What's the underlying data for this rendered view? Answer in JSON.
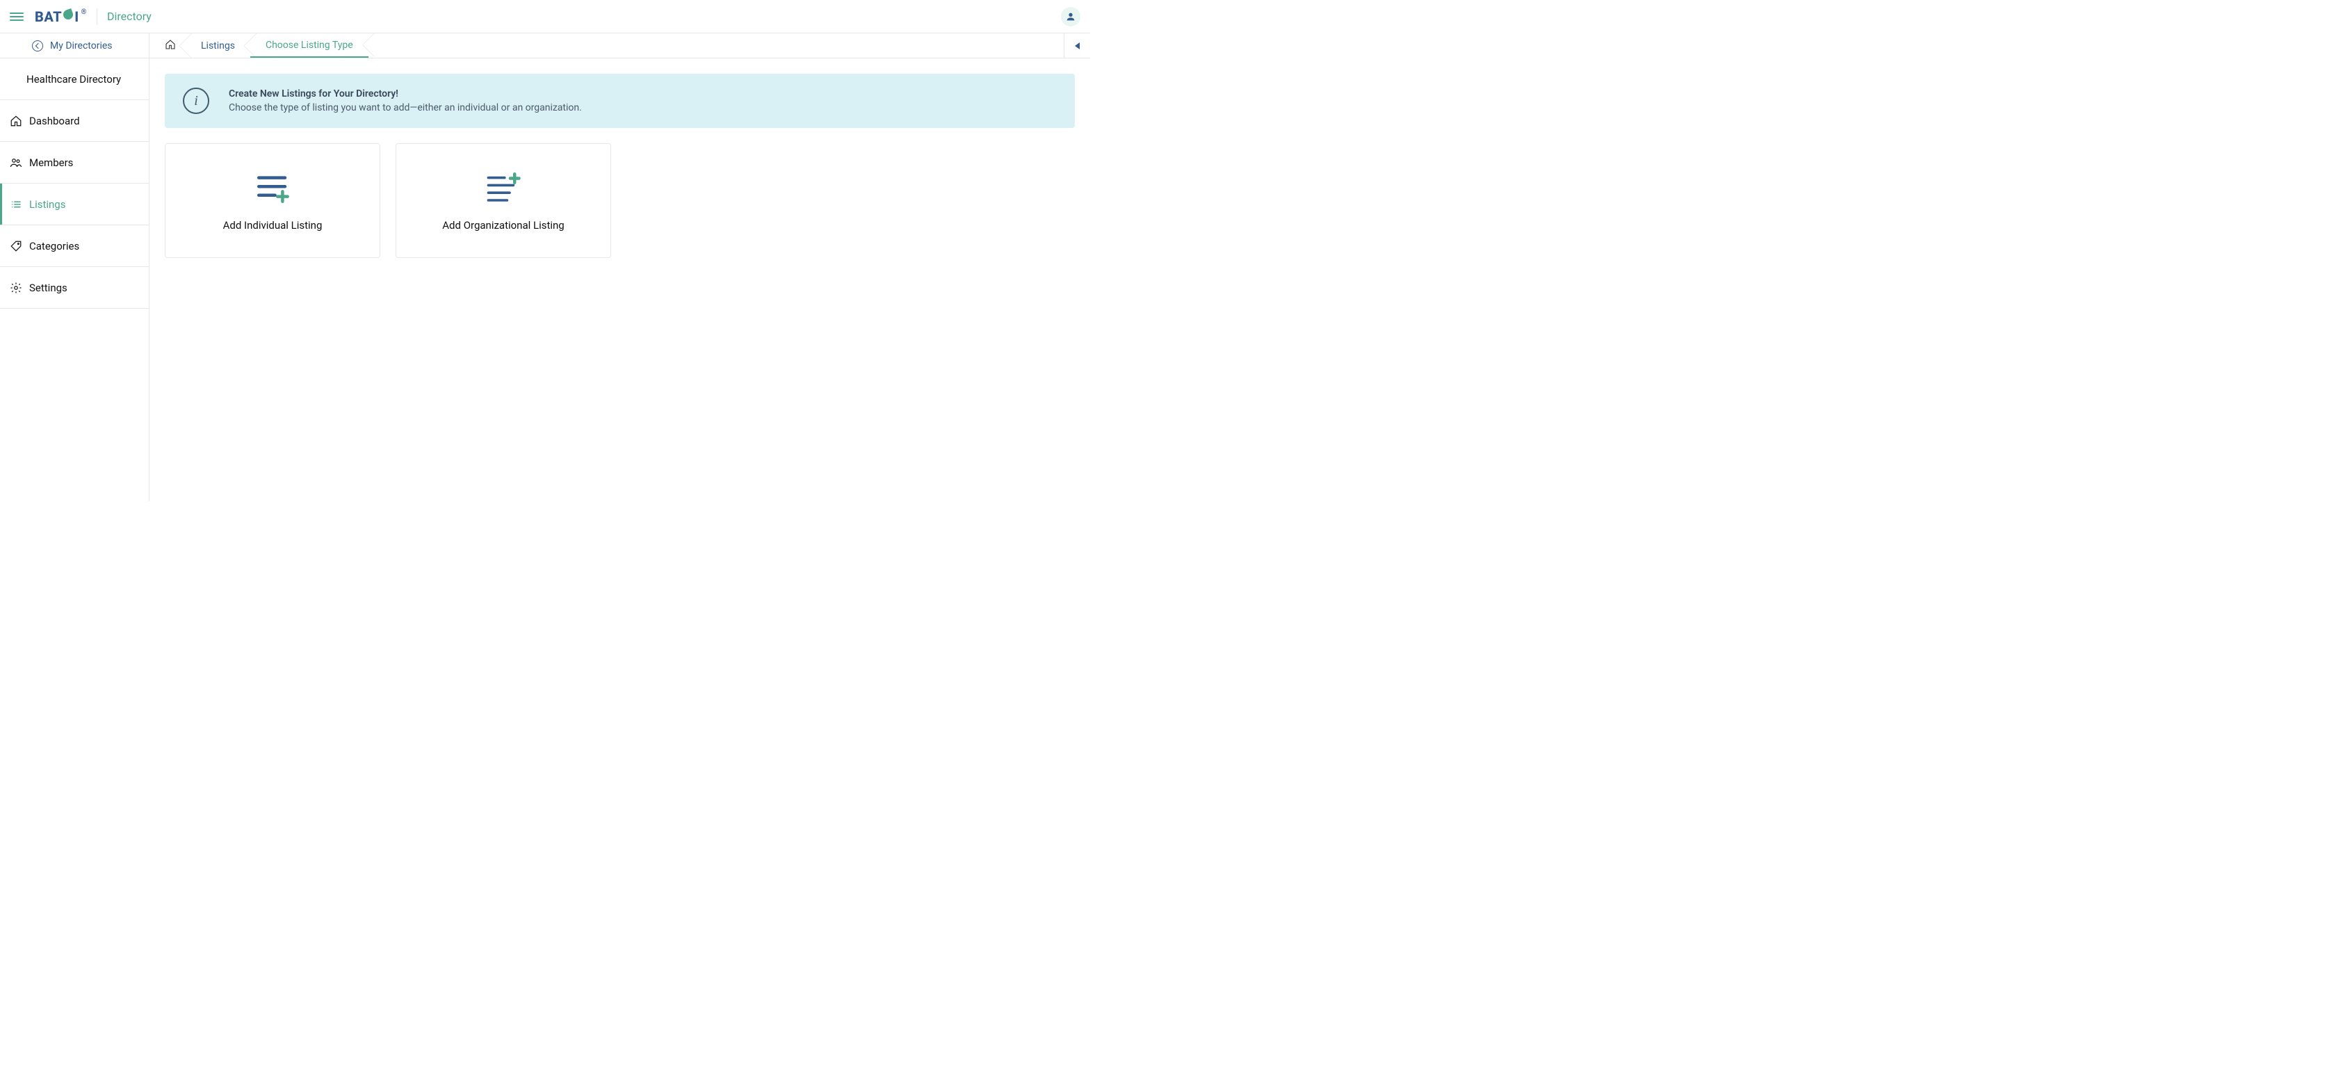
{
  "header": {
    "logo_text_a": "BAT",
    "logo_text_b": "I",
    "logo_reg": "®",
    "app_name": "Directory"
  },
  "sidebar": {
    "back_label": "My Directories",
    "directory_name": "Healthcare Directory",
    "nav": [
      {
        "label": "Dashboard",
        "icon": "home-icon",
        "active": false
      },
      {
        "label": "Members",
        "icon": "members-icon",
        "active": false
      },
      {
        "label": "Listings",
        "icon": "listings-icon",
        "active": true
      },
      {
        "label": "Categories",
        "icon": "tag-icon",
        "active": false
      },
      {
        "label": "Settings",
        "icon": "gear-icon",
        "active": false
      }
    ]
  },
  "breadcrumb": {
    "items": [
      {
        "label": "Listings",
        "active": false
      },
      {
        "label": "Choose Listing Type",
        "active": true
      }
    ]
  },
  "info_panel": {
    "title": "Create New Listings for Your Directory!",
    "subtitle": "Choose the type of listing you want to add—either an individual or an organization."
  },
  "cards": [
    {
      "label": "Add Individual Listing",
      "icon": "list-plus-bottom-icon"
    },
    {
      "label": "Add Organizational Listing",
      "icon": "list-plus-top-icon"
    }
  ]
}
